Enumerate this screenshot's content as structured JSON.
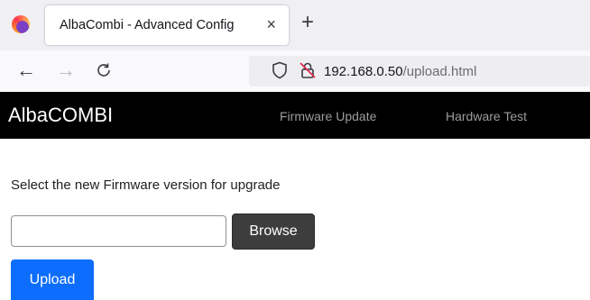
{
  "browser": {
    "tab_title": "AlbaCombi - Advanced Config",
    "tab_close": "×",
    "new_tab": "+",
    "url_host": "192.168.0.50",
    "url_path": "/upload.html",
    "icons": [
      "firefox-logo",
      "back-arrow",
      "forward-arrow",
      "reload",
      "shield",
      "insecure-lock"
    ]
  },
  "site": {
    "brand": "AlbaCOMBI",
    "nav": [
      "Firmware Update",
      "Hardware Test"
    ],
    "header_bg": "#000000"
  },
  "upload": {
    "prompt": "Select the new Firmware version for upgrade",
    "file_value": "",
    "browse_label": "Browse",
    "upload_label": "Upload",
    "accent": "#0d6efd"
  }
}
